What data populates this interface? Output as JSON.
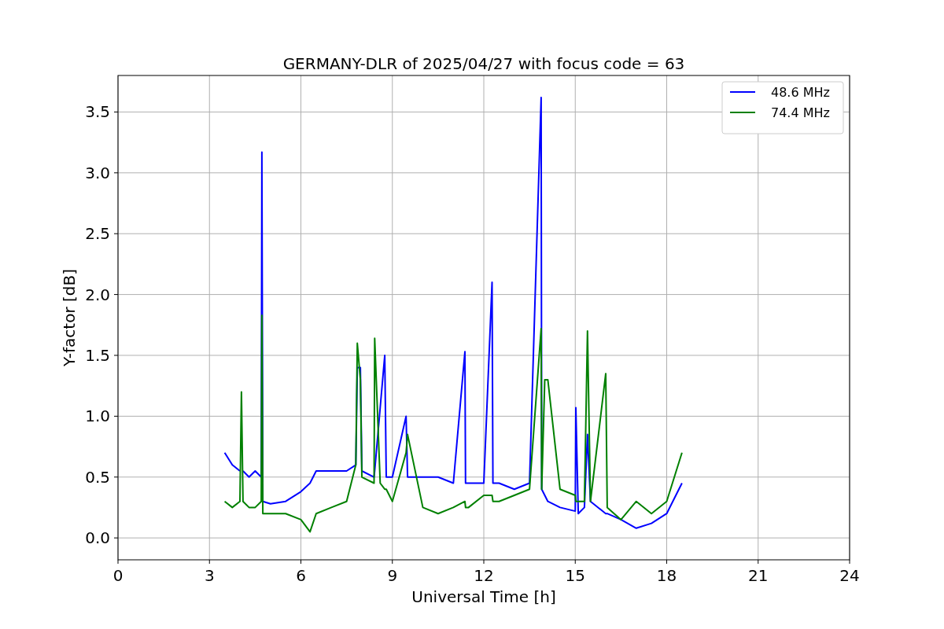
{
  "figure": {
    "chart_data": {
      "type": "line",
      "title": "GERMANY-DLR of 2025/04/27 with focus code = 63",
      "xlabel": "Universal Time [h]",
      "ylabel": "Y-factor [dB]",
      "x": [
        3.5,
        3.75,
        4.0,
        4.05,
        4.1,
        4.3,
        4.5,
        4.7,
        4.72,
        4.75,
        5.0,
        5.5,
        6.0,
        6.3,
        6.5,
        7.0,
        7.5,
        7.8,
        7.85,
        7.95,
        8.0,
        8.4,
        8.42,
        8.6,
        8.75,
        8.8,
        9.0,
        9.45,
        9.5,
        10.0,
        10.5,
        11.0,
        11.38,
        11.4,
        11.5,
        12.0,
        12.27,
        12.3,
        12.5,
        13.0,
        13.5,
        13.88,
        13.9,
        14.0,
        14.1,
        14.5,
        15.0,
        15.02,
        15.1,
        15.3,
        15.4,
        15.5,
        16.0,
        16.05,
        16.5,
        17.0,
        17.5,
        18.0,
        18.5
      ],
      "series": [
        {
          "name": "48.6 MHz",
          "color": "#0000ff",
          "values": [
            0.7,
            0.6,
            0.55,
            null,
            0.55,
            0.5,
            0.55,
            0.5,
            3.17,
            0.3,
            0.28,
            0.3,
            0.38,
            0.45,
            0.55,
            0.55,
            0.55,
            0.6,
            1.4,
            1.4,
            0.55,
            0.5,
            0.55,
            1.07,
            1.5,
            0.5,
            0.5,
            1.0,
            0.5,
            0.5,
            0.5,
            0.45,
            1.53,
            0.45,
            0.45,
            0.45,
            2.1,
            0.45,
            0.45,
            0.4,
            0.45,
            3.62,
            0.4,
            0.35,
            0.3,
            0.25,
            0.22,
            1.07,
            0.2,
            0.25,
            0.85,
            0.3,
            0.2,
            0.2,
            0.15,
            0.08,
            0.12,
            0.2,
            0.45
          ]
        },
        {
          "name": "74.4 MHz",
          "color": "#008000",
          "values": [
            0.3,
            0.25,
            0.3,
            1.2,
            0.3,
            0.25,
            0.25,
            0.3,
            1.83,
            0.2,
            0.2,
            0.2,
            0.15,
            0.05,
            0.2,
            0.25,
            0.3,
            0.6,
            1.6,
            1.3,
            0.5,
            0.45,
            1.64,
            0.45,
            0.4,
            0.4,
            0.3,
            0.7,
            0.85,
            0.25,
            0.2,
            0.25,
            0.3,
            0.25,
            0.25,
            0.35,
            0.35,
            0.3,
            0.3,
            0.35,
            0.4,
            1.72,
            0.4,
            1.3,
            1.3,
            0.4,
            0.35,
            0.3,
            0.3,
            0.3,
            1.7,
            0.3,
            1.35,
            0.25,
            0.15,
            0.3,
            0.2,
            0.3,
            0.7
          ]
        }
      ],
      "grid": true,
      "legend": true,
      "xlim": [
        0,
        24
      ],
      "ylim": [
        -0.18,
        3.8
      ],
      "xticks": [
        0,
        3,
        6,
        9,
        12,
        15,
        18,
        21,
        24
      ],
      "yticks": [
        {
          "value": 0,
          "label": "0.0"
        },
        {
          "value": 0.5,
          "label": "0.5"
        },
        {
          "value": 1,
          "label": "1.0"
        },
        {
          "value": 1.5,
          "label": "1.5"
        },
        {
          "value": 2,
          "label": "2.0"
        },
        {
          "value": 2.5,
          "label": "2.5"
        },
        {
          "value": 3,
          "label": "3.0"
        },
        {
          "value": 3.5,
          "label": "3.5"
        }
      ]
    }
  }
}
